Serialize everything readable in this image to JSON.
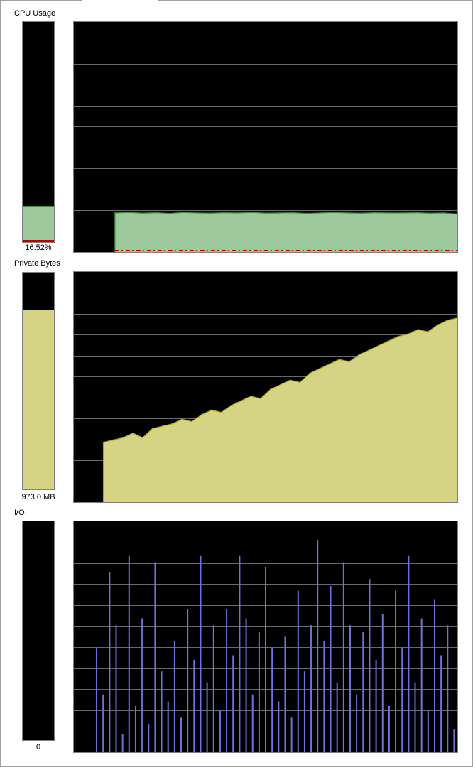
{
  "panels": {
    "cpu": {
      "title": "CPU Usage",
      "value_label": "16.52%",
      "meter_fraction": 0.1652,
      "kernel_fraction": 0.012,
      "fill_color": "#9dc99d",
      "line_color": "#3f8f3f",
      "kernel_color": "#c00000"
    },
    "private_bytes": {
      "title": "Private Bytes",
      "value_label": "973.0 MB",
      "meter_fraction": 0.83,
      "fill_color": "#d4d484",
      "line_color": "#a8a800"
    },
    "io": {
      "title": "I/O",
      "value_label": "0",
      "meter_fraction": 0,
      "bar_color": "#7070e0"
    }
  },
  "chart_data": [
    {
      "type": "area",
      "series": [
        {
          "values": [
            0,
            0,
            0,
            17.0,
            17.2,
            16.9,
            17.1,
            16.8,
            17.2,
            17.0,
            16.9,
            17.1,
            17.0,
            17.2,
            16.9,
            17.0,
            17.1,
            16.8,
            17.0,
            17.2,
            17.0,
            16.9,
            17.1,
            17.0,
            17.0,
            17.1,
            16.9,
            17.0,
            16.52
          ]
        }
      ],
      "ylim": [
        0,
        100
      ],
      "grid": true
    },
    {
      "type": "area",
      "series": [
        {
          "values": [
            0,
            0,
            0,
            26,
            27,
            28,
            30,
            28,
            32,
            33,
            34,
            36,
            35,
            38,
            40,
            39,
            42,
            44,
            46,
            45,
            49,
            51,
            53,
            52,
            56,
            58,
            60,
            62,
            61,
            64,
            66,
            68,
            70,
            72,
            73,
            75,
            74,
            77,
            79,
            80
          ]
        }
      ],
      "ylim": [
        0,
        100
      ],
      "grid": true
    },
    {
      "type": "bar",
      "series": [
        {
          "values": [
            0,
            0,
            0,
            45,
            25,
            78,
            55,
            8,
            85,
            20,
            58,
            12,
            82,
            35,
            22,
            48,
            15,
            62,
            40,
            85,
            30,
            55,
            18,
            62,
            42,
            85,
            58,
            25,
            52,
            80,
            45,
            22,
            50,
            15,
            70,
            35,
            55,
            92,
            48,
            72,
            30,
            82,
            55,
            25,
            52,
            75,
            40,
            60,
            20,
            70,
            45,
            85,
            30,
            58,
            18,
            66,
            42,
            55,
            10
          ]
        }
      ],
      "ylim": [
        0,
        100
      ],
      "grid": true
    }
  ]
}
